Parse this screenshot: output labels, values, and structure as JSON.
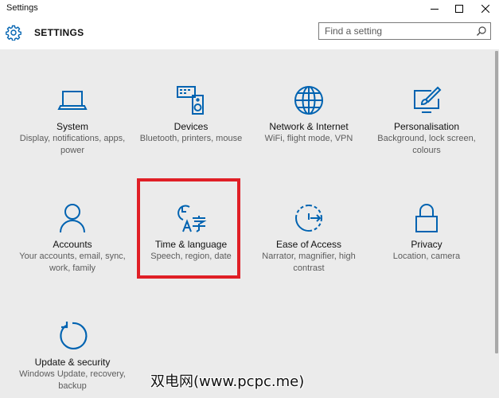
{
  "window": {
    "title": "Settings",
    "controls": {
      "minimize_icon": "minimize-icon",
      "maximize_icon": "maximize-icon",
      "close_icon": "close-icon"
    }
  },
  "header": {
    "title": "SETTINGS",
    "search": {
      "placeholder": "Find a setting",
      "value": ""
    }
  },
  "tiles": [
    {
      "title": "System",
      "desc": "Display, notifications, apps, power",
      "icon": "laptop-icon"
    },
    {
      "title": "Devices",
      "desc": "Bluetooth, printers, mouse",
      "icon": "keyboard-speaker-icon"
    },
    {
      "title": "Network & Internet",
      "desc": "WiFi, flight mode, VPN",
      "icon": "globe-icon"
    },
    {
      "title": "Personalisation",
      "desc": "Background, lock screen, colours",
      "icon": "paintbrush-screen-icon"
    },
    {
      "title": "Accounts",
      "desc": "Your accounts, email, sync, work, family",
      "icon": "person-icon"
    },
    {
      "title": "Time & language",
      "desc": "Speech, region, date",
      "icon": "clock-language-icon"
    },
    {
      "title": "Ease of Access",
      "desc": "Narrator, magnifier, high contrast",
      "icon": "ease-of-access-icon"
    },
    {
      "title": "Privacy",
      "desc": "Location, camera",
      "icon": "padlock-icon"
    },
    {
      "title": "Update & security",
      "desc": "Windows Update, recovery, backup",
      "icon": "refresh-icon"
    }
  ],
  "watermark": "双电网(www.pcpc.me)",
  "colors": {
    "accent": "#0063b1",
    "highlight": "#e01f26",
    "background": "#ebebeb"
  }
}
